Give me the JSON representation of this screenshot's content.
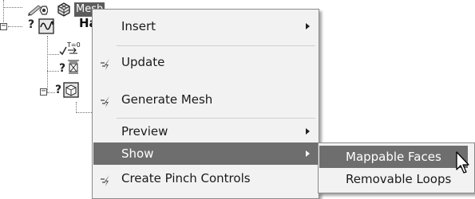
{
  "tree": {
    "mesh_label": "Mesh",
    "harr_label": "Harr",
    "unknown_marker": "?",
    "collapse_glyph": "−",
    "icons": [
      "mesh-icon",
      "harmonic-analysis-icon",
      "temperature-condition-icon",
      "boundary-condition-icon",
      "mesh-control-icon"
    ]
  },
  "menu": {
    "items": [
      {
        "label": "Insert",
        "submenu": true,
        "icon": null
      },
      {
        "label": "Update",
        "submenu": false,
        "icon": "update-lightning-icon"
      },
      {
        "label": "Generate Mesh",
        "submenu": false,
        "icon": "generate-mesh-lightning-icon"
      },
      {
        "label": "Preview",
        "submenu": true,
        "icon": null
      },
      {
        "label": "Show",
        "submenu": true,
        "icon": null,
        "highlighted": true
      },
      {
        "label": "Create Pinch Controls",
        "submenu": false,
        "icon": "pinch-lightning-icon"
      }
    ]
  },
  "submenu": {
    "items": [
      {
        "label": "Mappable Faces",
        "highlighted": true
      },
      {
        "label": "Removable Loops",
        "highlighted": false
      }
    ]
  },
  "colors": {
    "highlight": "#6e6e6e",
    "menu_bg": "#f2f2f2",
    "selected_node_bg": "#5c5c5c"
  }
}
